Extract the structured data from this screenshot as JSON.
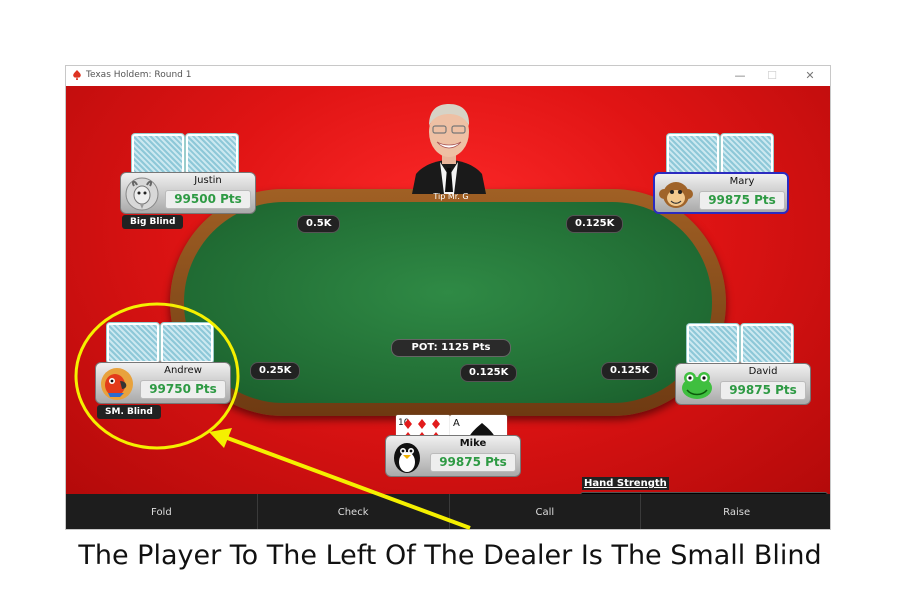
{
  "window": {
    "title": "Texas Holdem: Round 1",
    "controls": {
      "minimize": "—",
      "maximize": "☐",
      "close": "✕"
    }
  },
  "dealer": {
    "label": "Tip Mr. G"
  },
  "players": {
    "justin": {
      "name": "Justin",
      "points": "99500 Pts",
      "avatar": "goat-icon",
      "blind": "Big Blind"
    },
    "mary": {
      "name": "Mary",
      "points": "99875 Pts",
      "avatar": "monkey-icon"
    },
    "andrew": {
      "name": "Andrew",
      "points": "99750 Pts",
      "avatar": "parrot-icon",
      "blind": "SM. Blind"
    },
    "david": {
      "name": "David",
      "points": "99875 Pts",
      "avatar": "frog-icon"
    },
    "mike": {
      "name": "Mike",
      "points": "99875 Pts",
      "avatar": "penguin-icon"
    }
  },
  "bets": {
    "justin": "0.5K",
    "mary": "0.125K",
    "andrew": "0.25K",
    "mike": "0.125K",
    "david": "0.125K"
  },
  "pot": "POT: 1125 Pts",
  "hole_cards": [
    {
      "rank": "10",
      "suit": "diamonds",
      "color": "#e21b1b"
    },
    {
      "rank": "A",
      "suit": "spades",
      "color": "#111111"
    }
  ],
  "hand_strength": {
    "label": "Hand Strength",
    "level": 0.38,
    "color": "#ffff1a"
  },
  "actions": {
    "fold": "Fold",
    "check": "Check",
    "call": "Call",
    "raise": "Raise"
  },
  "annotation": {
    "caption": "The Player To The Left Of The Dealer Is The Small Blind",
    "highlight_color": "#f5f000"
  }
}
